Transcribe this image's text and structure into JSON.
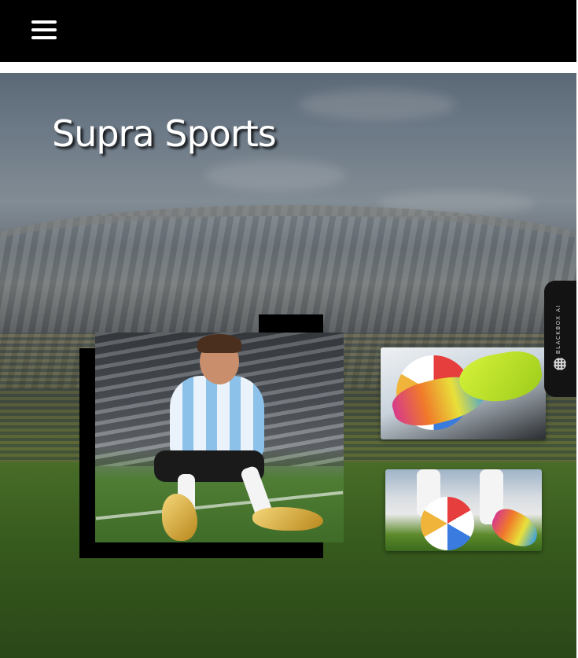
{
  "header": {
    "menu_icon": "hamburger-menu-icon"
  },
  "hero": {
    "title": "Supra Sports",
    "background": "stadium-photo"
  },
  "gallery": {
    "main_image": "player-sitting-with-golden-boots-photo",
    "thumbnails": [
      "colorful-football-boots-with-ball-photo",
      "ball-and-boots-on-pitch-photo"
    ]
  },
  "side_widget": {
    "label": "BLACKBOX AI",
    "icon": "dotted-globe-icon"
  },
  "colors": {
    "topbar": "#000000",
    "title": "#ffffff",
    "frame": "#000000",
    "widget": "#131313"
  }
}
